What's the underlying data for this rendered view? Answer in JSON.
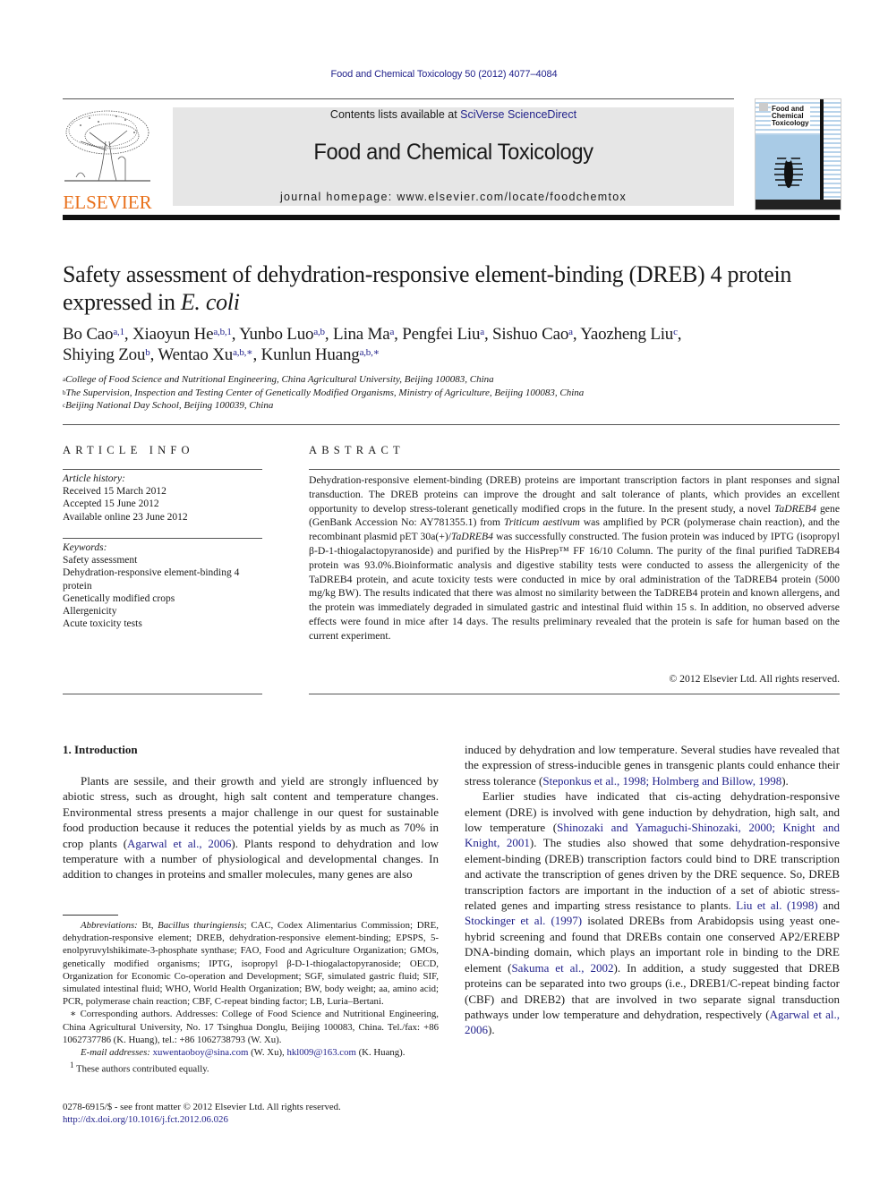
{
  "header": {
    "citation": "Food and Chemical Toxicology 50 (2012) 4077–4084",
    "contents_prefix": "Contents lists available at ",
    "contents_link": "SciVerse ScienceDirect",
    "journal_name": "Food and Chemical Toxicology",
    "homepage": "journal homepage: www.elsevier.com/locate/foodchemtox",
    "publisher_logo_text": "ELSEVIER",
    "cover_title_lines": [
      "Food and",
      "Chemical",
      "Toxicology"
    ],
    "colors": {
      "publisher_orange": "#e9711c",
      "link_blue": "#1f1f8a",
      "header_gray": "#e6e6e6"
    }
  },
  "article": {
    "title_main": "Safety assessment of dehydration-responsive element-binding (DREB) 4 protein expressed in ",
    "title_italic": "E. coli",
    "authors": [
      {
        "name": "Bo Cao",
        "sup": "a,1"
      },
      {
        "name": "Xiaoyun He",
        "sup": "a,b,1"
      },
      {
        "name": "Yunbo Luo",
        "sup": "a,b"
      },
      {
        "name": "Lina Ma",
        "sup": "a"
      },
      {
        "name": "Pengfei Liu",
        "sup": "a"
      },
      {
        "name": "Sishuo Cao",
        "sup": "a"
      },
      {
        "name": "Yaozheng Liu",
        "sup": "c"
      },
      {
        "name": "Shiying Zou",
        "sup": "b"
      },
      {
        "name": "Wentao Xu",
        "sup": "a,b,∗"
      },
      {
        "name": "Kunlun Huang",
        "sup": "a,b,∗"
      }
    ],
    "affiliations": [
      {
        "mark": "a",
        "text": "College of Food Science and Nutritional Engineering, China Agricultural University, Beijing 100083, China"
      },
      {
        "mark": "b",
        "text": "The Supervision, Inspection and Testing Center of Genetically Modified Organisms, Ministry of Agriculture, Beijing 100083, China"
      },
      {
        "mark": "c",
        "text": "Beijing National Day School, Beijing 100039, China"
      }
    ]
  },
  "article_info": {
    "heading": "ARTICLE INFO",
    "history_label": "Article history:",
    "history": [
      "Received 15 March 2012",
      "Accepted 15 June 2012",
      "Available online 23 June 2012"
    ],
    "keywords_label": "Keywords:",
    "keywords": [
      "Safety assessment",
      "Dehydration-responsive element-binding 4 protein",
      "Genetically modified crops",
      "Allergenicity",
      "Acute toxicity tests"
    ]
  },
  "abstract": {
    "heading": "ABSTRACT",
    "p1": "Dehydration-responsive element-binding (DREB) proteins are important transcription factors in plant responses and signal transduction. The DREB proteins can improve the drought and salt tolerance of plants, which provides an excellent opportunity to develop stress-tolerant genetically modified crops in the future. In the present study, a novel ",
    "gene_italic": "TaDREB4",
    "p2": " gene (GenBank Accession No: AY781355.1) from ",
    "species_italic": "Triticum aestivum",
    "p3": " was amplified by PCR (polymerase chain reaction), and the recombinant plasmid pET 30a(+)/",
    "plasmid_italic": "TaDREB4",
    "p4": " was successfully constructed. The fusion protein was induced by IPTG (isopropyl β-D-1-thiogalactopyranoside) and purified by the HisPrep™ FF 16/10 Column. The purity of the final purified TaDREB4 protein was 93.0%.Bioinformatic analysis and digestive stability tests were conducted to assess the allergenicity of the TaDREB4 protein, and acute toxicity tests were conducted in mice by oral administration of the TaDREB4 protein (5000 mg/kg BW). The results indicated that there was almost no similarity between the TaDREB4 protein and known allergens, and the protein was immediately degraded in simulated gastric and intestinal fluid within 15 s. In addition, no observed adverse effects were found in mice after 14 days. The results preliminary revealed that the protein is safe for human based on the current experiment.",
    "copyright": "© 2012 Elsevier Ltd. All rights reserved."
  },
  "body": {
    "section_heading": "1. Introduction",
    "left_p1a": "Plants are sessile, and their growth and yield are strongly influenced by abiotic stress, such as drought, high salt content and temperature changes. Environmental stress presents a major challenge in our quest for sustainable food production because it reduces the potential yields by as much as 70% in crop plants (",
    "left_ref1": "Agarwal et al., 2006",
    "left_p1b": "). Plants respond to dehydration and low temperature with a number of physiological and developmental changes. In addition to changes in proteins and smaller molecules, many genes are also",
    "right_p1a": "induced by dehydration and low temperature. Several studies have revealed that the expression of stress-inducible genes in transgenic plants could enhance their stress tolerance (",
    "right_ref1": "Steponkus et al., 1998; Holmberg and Billow, 1998",
    "right_p1b": ").",
    "right_p2a": "Earlier studies have indicated that cis-acting dehydration-responsive element (DRE) is involved with gene induction by dehydration, high salt, and low temperature (",
    "right_ref2": "Shinozaki and Yamaguchi-Shinozaki, 2000; Knight and Knight, 2001",
    "right_p2b": "). The studies also showed that some dehydration-responsive element-binding (DREB) transcription factors could bind to DRE transcription and activate the transcription of genes driven by the DRE sequence. So, DREB transcription factors are important in the induction of a set of abiotic stress-related genes and imparting stress resistance to plants. ",
    "right_ref3": "Liu et al. (1998)",
    "right_p2c": " and ",
    "right_ref4": "Stockinger et al. (1997)",
    "right_p2d": " isolated DREBs from Arabidopsis using yeast one-hybrid screening and found that DREBs contain one conserved AP2/EREBP DNA-binding domain, which plays an important role in binding to the DRE element (",
    "right_ref5": "Sakuma et al., 2002",
    "right_p2e": "). In addition, a study suggested that DREB proteins can be separated into two groups (i.e., DREB1/C-repeat binding factor (CBF) and DREB2) that are involved in two separate signal transduction pathways under low temperature and dehydration, respectively (",
    "right_ref6": "Agarwal et al., 2006",
    "right_p2f": ")."
  },
  "footnotes": {
    "abbrev_label": "Abbreviations:",
    "abbrev_a": " Bt, ",
    "abbrev_bt_italic": "Bacillus thuringiensis",
    "abbrev_b": "; CAC, Codex Alimentarius Commission; DRE, dehydration-responsive element; DREB, dehydration-responsive element-binding; EPSPS, 5-enolpyruvylshikimate-3-phosphate synthase; FAO, Food and Agriculture Organization; GMOs, genetically modified organisms; IPTG, isopropyl β-D-1-thiogalactopyranoside; OECD, Organization for Economic Co-operation and Development; SGF, simulated gastric fluid; SIF, simulated intestinal fluid; WHO, World Health Organization; BW, body weight; aa, amino acid; PCR, polymerase chain reaction; CBF, C-repeat binding factor; LB, Luria–Bertani.",
    "corresponding": "∗ Corresponding authors. Addresses: College of Food Science and Nutritional Engineering, China Agricultural University, No. 17 Tsinghua Donglu, Beijing 100083, China. Tel./fax: +86 1062737786 (K. Huang), tel.: +86 1062738793 (W. Xu).",
    "email_label": "E-mail addresses:",
    "email1": "xuwentaoboy@sina.com",
    "email1_owner": " (W. Xu), ",
    "email2": "hkl009@163.com",
    "email2_owner": " (K. Huang).",
    "equal_mark": "1",
    "equal_text": " These authors contributed equally.",
    "front_matter": "0278-6915/$ - see front matter © 2012 Elsevier Ltd. All rights reserved.",
    "doi": "http://dx.doi.org/10.1016/j.fct.2012.06.026"
  }
}
